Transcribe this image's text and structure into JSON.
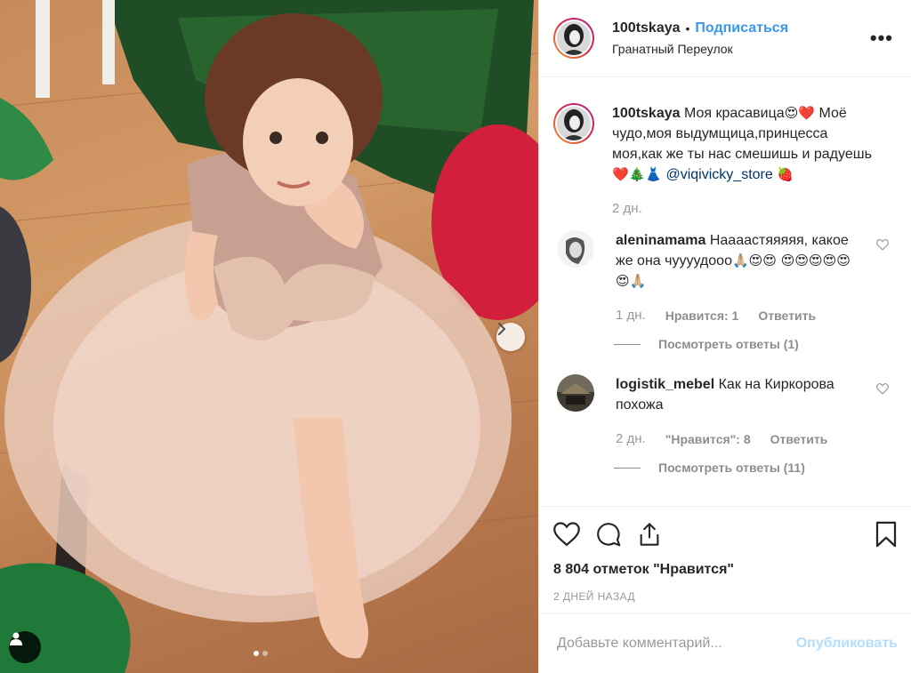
{
  "post": {
    "username": "100tskaya",
    "follow_label": "Подписаться",
    "separator": "•",
    "location": "Гранатный Переулок",
    "more_label": "•••"
  },
  "caption": {
    "username": "100tskaya",
    "text_1": "Моя красавица",
    "emoji_1": "😍❤️",
    "text_2": " Моё чудо,моя выдумщица,принцесса моя,как же ты нас смешишь и радуешь",
    "emoji_2": "❤️🎄👗",
    "mention": "@viqivicky_store",
    "emoji_3": "🍓",
    "time": "2 дн."
  },
  "comments": [
    {
      "username": "aleninamama",
      "text": "Наааастяяяяя, какое же она чуууудооо",
      "emoji": "🙏🏼😍😍 😍😍😍😍😍😍🙏🏼",
      "time": "1 дн.",
      "likes": "Нравится: 1",
      "reply": "Ответить",
      "view_replies": "Посмотреть ответы (1)"
    },
    {
      "username": "logistik_mebel",
      "text": "Как на Киркорова похожа",
      "emoji": "",
      "time": "2 дн.",
      "likes": "\"Нравится\": 8",
      "reply": "Ответить",
      "view_replies": "Посмотреть ответы (11)"
    }
  ],
  "engagement": {
    "likes": "8 804 отметок \"Нравится\"",
    "date": "2 ДНЕЙ НАЗАД"
  },
  "add_comment": {
    "placeholder": "Добавьте комментарий...",
    "publish": "Опубликовать"
  },
  "icons": {
    "like": "heart-icon",
    "comment": "comment-icon",
    "share": "share-icon",
    "save": "bookmark-icon",
    "next": "chevron-right-icon",
    "tag": "user-tag-icon"
  },
  "colors": {
    "link_blue": "#3897f0",
    "publish_disabled": "#b2dffc",
    "muted": "#999999",
    "text": "#262626"
  }
}
